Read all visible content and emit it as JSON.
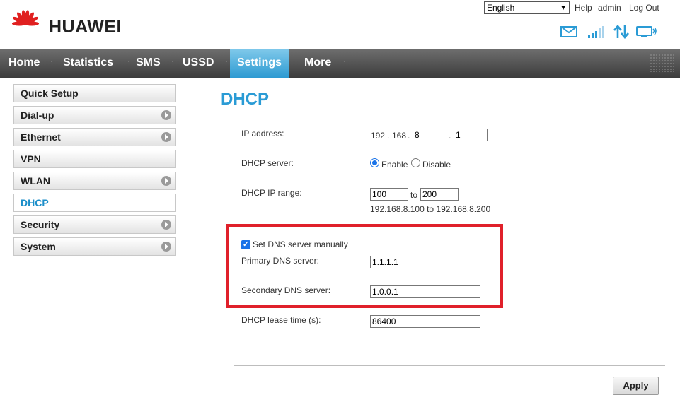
{
  "header": {
    "brand": "HUAWEI",
    "language": "English",
    "links": {
      "help": "Help",
      "user": "admin",
      "logout": "Log Out"
    },
    "accent_color": "#2a9bd5",
    "logo_color": "#e02020",
    "status_icons": [
      "mail-icon",
      "signal-strength-icon",
      "data-transfer-icon",
      "connection-icon"
    ]
  },
  "nav": {
    "items": [
      {
        "label": "Home"
      },
      {
        "label": "Statistics"
      },
      {
        "label": "SMS"
      },
      {
        "label": "USSD"
      },
      {
        "label": "Settings",
        "active": true
      },
      {
        "label": "More"
      }
    ]
  },
  "sidebar": {
    "items": [
      {
        "label": "Quick Setup"
      },
      {
        "label": "Dial-up"
      },
      {
        "label": "Ethernet"
      },
      {
        "label": "VPN"
      },
      {
        "label": "WLAN"
      },
      {
        "label": "DHCP",
        "active": true
      },
      {
        "label": "Security"
      },
      {
        "label": "System"
      }
    ]
  },
  "main": {
    "title": "DHCP",
    "ip": {
      "label": "IP address:",
      "prefix1": "192",
      "dot": ".",
      "prefix2": "168",
      "octet3": "8",
      "octet4": "1"
    },
    "dhcp_server": {
      "label": "DHCP server:",
      "enable": "Enable",
      "disable": "Disable",
      "selected": "Enable"
    },
    "ip_range": {
      "label": "DHCP IP range:",
      "from": "100",
      "to_label": "to",
      "to": "200",
      "summary": "192.168.8.100 to 192.168.8.200"
    },
    "dns": {
      "manual_label": "Set DNS server manually",
      "manual_checked": true,
      "primary_label": "Primary DNS server:",
      "primary": "1.1.1.1",
      "secondary_label": "Secondary DNS server:",
      "secondary": "1.0.0.1",
      "highlight_color": "#e0202a"
    },
    "lease": {
      "label": "DHCP lease time (s):",
      "value": "86400"
    },
    "apply_label": "Apply"
  }
}
